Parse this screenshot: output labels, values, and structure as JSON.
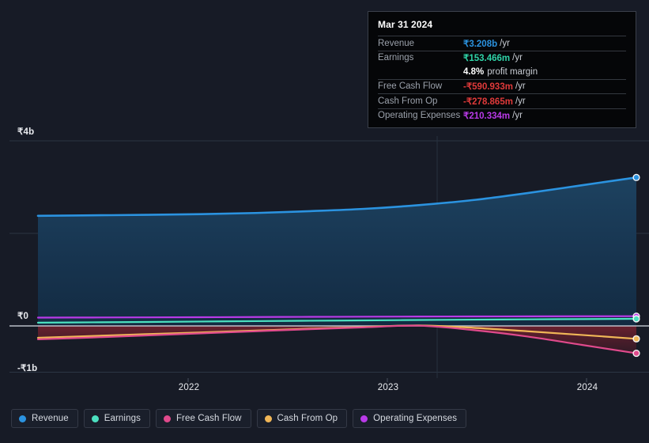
{
  "chart_data": {
    "type": "area",
    "title": "",
    "xlabel": "",
    "ylabel": "",
    "currency_symbol": "₹",
    "x_tick_labels": [
      "2022",
      "2023",
      "2024"
    ],
    "y_tick_labels": [
      "₹4b",
      "₹0",
      "-₹1b"
    ],
    "ylim": [
      -1000000000,
      4000000000
    ],
    "grid": true,
    "legend_position": "bottom",
    "x": [
      "2021-06",
      "2021-09",
      "2021-12",
      "2022-03",
      "2022-06",
      "2022-09",
      "2022-12",
      "2023-03",
      "2023-06",
      "2023-09",
      "2023-12",
      "2024-03"
    ],
    "series": [
      {
        "name": "Revenue",
        "color": "#2b93e0",
        "fill": true,
        "values": [
          2380000000,
          2390000000,
          2400000000,
          2415000000,
          2440000000,
          2480000000,
          2530000000,
          2610000000,
          2720000000,
          2870000000,
          3040000000,
          3208000000
        ]
      },
      {
        "name": "Earnings",
        "color": "#4ce0c0",
        "fill": false,
        "values": [
          70000000,
          78000000,
          86000000,
          95000000,
          104000000,
          112000000,
          120000000,
          128000000,
          136000000,
          142000000,
          148000000,
          153466000
        ]
      },
      {
        "name": "Free Cash Flow",
        "color": "#e04a8c",
        "fill": false,
        "values": [
          -290000000,
          -250000000,
          -205000000,
          -160000000,
          -115000000,
          -70000000,
          -30000000,
          5000000,
          -90000000,
          -230000000,
          -410000000,
          -590933000
        ]
      },
      {
        "name": "Cash From Op",
        "color": "#f0b657",
        "fill": false,
        "values": [
          -255000000,
          -218000000,
          -178000000,
          -140000000,
          -100000000,
          -60000000,
          -22000000,
          12000000,
          -40000000,
          -115000000,
          -195000000,
          -278865000
        ]
      },
      {
        "name": "Operating Expenses",
        "color": "#b93ae8",
        "fill": false,
        "values": [
          180000000,
          182000000,
          185000000,
          188000000,
          192000000,
          196000000,
          200000000,
          203000000,
          205000000,
          207000000,
          209000000,
          210334000
        ]
      }
    ]
  },
  "tooltip": {
    "title": "Mar 31 2024",
    "rows": [
      {
        "label": "Revenue",
        "value": "₹3.208b",
        "unit": "/yr",
        "color": "#2b93e0"
      },
      {
        "label": "Earnings",
        "value": "₹153.466m",
        "unit": "/yr",
        "color": "#2fd4a8"
      },
      {
        "label": "",
        "value": "4.8%",
        "unit": "",
        "sub": "profit margin",
        "color": "#ffffff"
      },
      {
        "label": "Free Cash Flow",
        "value": "-₹590.933m",
        "unit": "/yr",
        "color": "#e03a3a"
      },
      {
        "label": "Cash From Op",
        "value": "-₹278.865m",
        "unit": "/yr",
        "color": "#e03a3a"
      },
      {
        "label": "Operating Expenses",
        "value": "₹210.334m",
        "unit": "/yr",
        "color": "#b93ae8"
      }
    ]
  },
  "legend": {
    "items": [
      {
        "label": "Revenue",
        "color": "#2b93e0"
      },
      {
        "label": "Earnings",
        "color": "#4ce0c0"
      },
      {
        "label": "Free Cash Flow",
        "color": "#e04a8c"
      },
      {
        "label": "Cash From Op",
        "color": "#f0b657"
      },
      {
        "label": "Operating Expenses",
        "color": "#b93ae8"
      }
    ]
  },
  "axis": {
    "y_ticks": [
      {
        "label": "₹4b",
        "value": 4000000000
      },
      {
        "label": "₹0",
        "value": 0
      },
      {
        "label": "-₹1b",
        "value": -1000000000
      }
    ],
    "x_ticks": [
      {
        "label": "2022"
      },
      {
        "label": "2023"
      },
      {
        "label": "2024"
      }
    ]
  },
  "colors": {
    "background": "#171b26",
    "revenue": "#2b93e0",
    "earnings": "#4ce0c0",
    "free_cash_flow": "#e04a8c",
    "cash_from_op": "#f0b657",
    "operating_expenses": "#b93ae8",
    "zero_line": "#c9ced6",
    "grid": "#2b3543"
  }
}
